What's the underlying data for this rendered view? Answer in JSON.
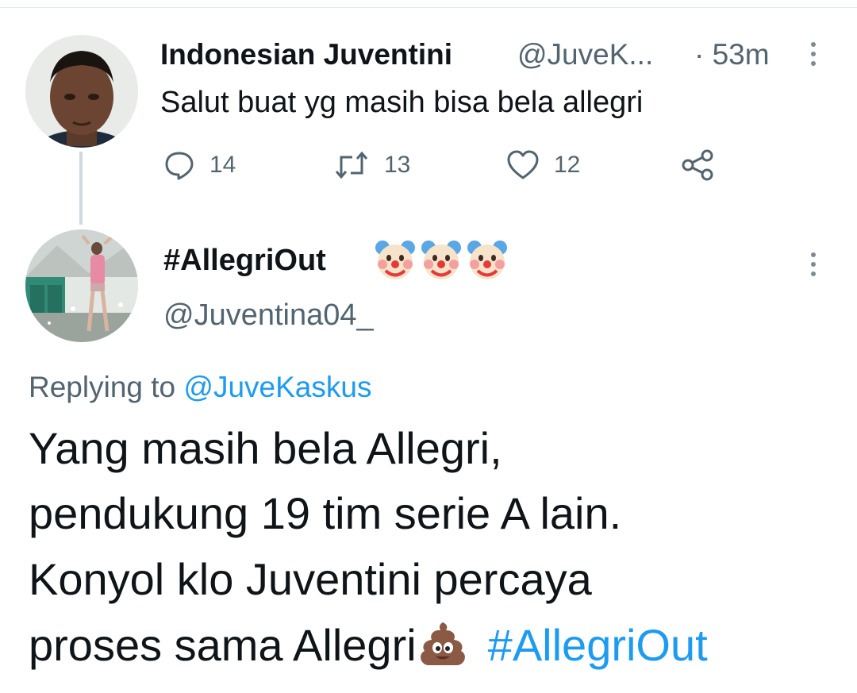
{
  "tweet1": {
    "author_name": "Indonesian Juventini",
    "author_handle": "@JuveK...",
    "timestamp": "· 53m",
    "text": "Salut buat yg masih bisa bela allegri",
    "replies": "14",
    "retweets": "13",
    "likes": "12"
  },
  "tweet2": {
    "author_name": "#AllegriOut",
    "author_emoji": "clown-face-emoji ×3",
    "author_handle": "@Juventina04_",
    "replying_prefix": "Replying to",
    "replying_to": "@JuveKaskus",
    "body_lines": [
      "Yang masih bela Allegri,",
      "pendukung 19 tim serie A lain.",
      "Konyol klo Juventini percaya",
      "proses sama Allegri"
    ],
    "hashtag": "#AllegriOut"
  },
  "colors": {
    "text": "#0f1419",
    "secondary": "#536471",
    "link": "#1d9bf0",
    "thread_line": "#cfd9de"
  },
  "icons": [
    "reply-icon",
    "retweet-icon",
    "like-icon",
    "share-icon",
    "more-options-icon",
    "clown-emoji",
    "poop-emoji"
  ]
}
